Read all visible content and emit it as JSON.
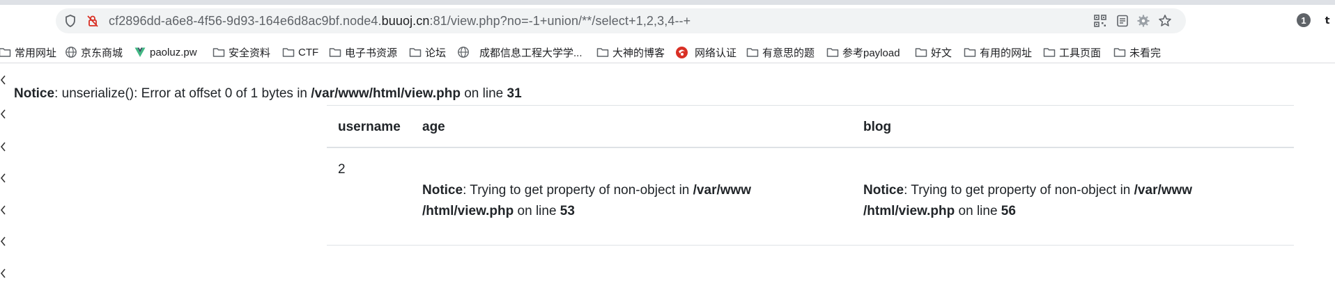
{
  "browser": {
    "url_prefix": "cf2896dd-a6e8-4f56-9d93-164e6d8ac9bf.node4.",
    "url_host": "buuoj.cn",
    "url_suffix": ":81/view.php?no=-1+union/**/select+1,2,3,4--+",
    "icons": [
      "shield-icon",
      "not-secure-icon",
      "qr-code-icon",
      "reader-mode-icon",
      "extension-icon",
      "star-icon",
      "profile-badge-icon",
      "tab-icon"
    ],
    "profile_badge": "1"
  },
  "bookmarks": [
    {
      "label": "常用网址",
      "icon": "folder-icon"
    },
    {
      "label": "京东商城",
      "icon": "globe-icon"
    },
    {
      "label": "paoluz.pw",
      "icon": "v-logo-icon"
    },
    {
      "label": "安全资料",
      "icon": "folder-icon"
    },
    {
      "label": "CTF",
      "icon": "folder-icon"
    },
    {
      "label": "电子书资源",
      "icon": "folder-icon"
    },
    {
      "label": "论坛",
      "icon": "folder-icon"
    },
    {
      "label": "成都信息工程大学学...",
      "icon": "globe-icon"
    },
    {
      "label": "大神的博客",
      "icon": "folder-icon"
    },
    {
      "label": "网络认证",
      "icon": "red-logo-icon"
    },
    {
      "label": "有意思的题",
      "icon": "folder-icon"
    },
    {
      "label": "参考payload",
      "icon": "folder-icon"
    },
    {
      "label": "好文",
      "icon": "folder-icon"
    },
    {
      "label": "有用的网址",
      "icon": "folder-icon"
    },
    {
      "label": "工具页面",
      "icon": "folder-icon"
    },
    {
      "label": "未看完",
      "icon": "folder-icon"
    }
  ],
  "page": {
    "notice_top": {
      "label": "Notice",
      "text": ": unserialize(): Error at offset 0 of 1 bytes in ",
      "file": "/var/www/html/view.php",
      "on_line": " on line ",
      "line": "31"
    },
    "table": {
      "headers": [
        "username",
        "age",
        "blog"
      ],
      "row": {
        "username": "2",
        "age": {
          "label": "Notice",
          "text": ": Trying to get property of non-object in ",
          "file1": "/var/www",
          "file2": "/html/view.php",
          "on_line": " on line ",
          "line": "53"
        },
        "blog": {
          "label": "Notice",
          "text": ": Trying to get property of non-object in ",
          "file1": "/var/www",
          "file2": "/html/view.php",
          "on_line": " on line ",
          "line": "56"
        }
      }
    }
  }
}
